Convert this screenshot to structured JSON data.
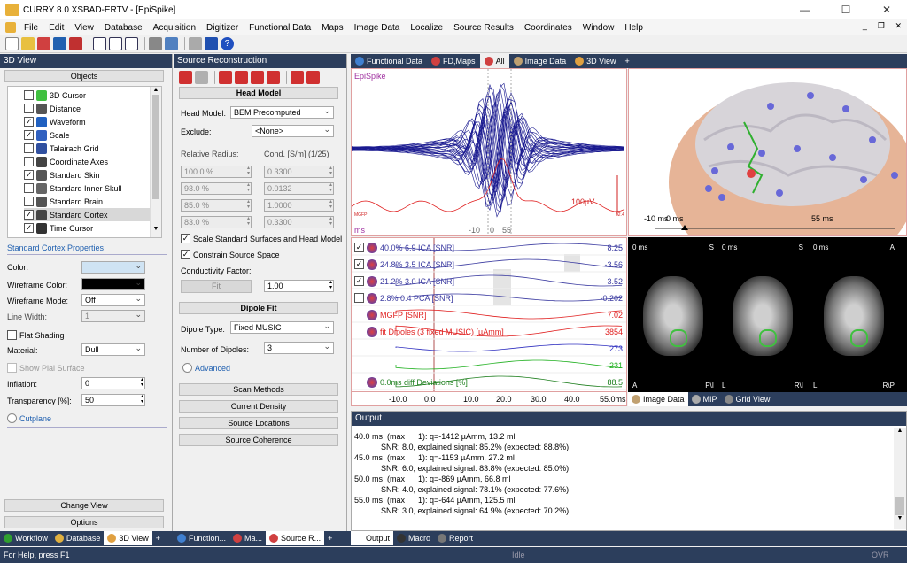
{
  "window": {
    "title": "CURRY 8.0 XSBAD-ERTV - [EpiSpike]",
    "min": "—",
    "max": "☐",
    "close": "✕"
  },
  "menu": [
    "File",
    "Edit",
    "View",
    "Database",
    "Acquisition",
    "Digitizer",
    "Functional Data",
    "Maps",
    "Image Data",
    "Localize",
    "Source Results",
    "Coordinates",
    "Window",
    "Help"
  ],
  "mdi": {
    "min": "_",
    "restore": "❐",
    "close": "✕"
  },
  "view3d": {
    "title": "3D View",
    "objects": "Objects",
    "items": [
      {
        "label": "3D Cursor",
        "checked": false
      },
      {
        "label": "Distance",
        "checked": false
      },
      {
        "label": "Waveform",
        "checked": true
      },
      {
        "label": "Scale",
        "checked": true
      },
      {
        "label": "Talairach Grid",
        "checked": false
      },
      {
        "label": "Coordinate Axes",
        "checked": false
      },
      {
        "label": "Standard Skin",
        "checked": true
      },
      {
        "label": "Standard Inner Skull",
        "checked": false
      },
      {
        "label": "Standard Brain",
        "checked": false
      },
      {
        "label": "Standard Cortex",
        "checked": true
      },
      {
        "label": "Time Cursor",
        "checked": true
      }
    ],
    "props_title": "Standard Cortex Properties",
    "color": "Color:",
    "wire_color": "Wireframe Color:",
    "wire_mode": "Wireframe Mode:",
    "wire_mode_val": "Off",
    "line_width": "Line Width:",
    "line_width_val": "1",
    "flat": "Flat Shading",
    "material": "Material:",
    "material_val": "Dull",
    "pial": "Show Pial Surface",
    "inflation": "Inflation:",
    "inflation_val": "0",
    "transparency": "Transparency [%]:",
    "transparency_val": "50",
    "cutplane": "Cutplane",
    "change_view": "Change View",
    "options": "Options"
  },
  "source": {
    "title": "Source Reconstruction",
    "head_model": "Head Model",
    "head_model_lbl": "Head Model:",
    "head_model_val": "BEM Precomputed",
    "exclude_lbl": "Exclude:",
    "exclude_val": "<None>",
    "rel_radius": "Relative Radius:",
    "cond": "Cond. [S/m] (1/25)",
    "radii": [
      "100.0 %",
      "93.0 %",
      "85.0 %",
      "83.0 %"
    ],
    "conds": [
      "0.3300",
      "0.0132",
      "1.0000",
      "0.3300"
    ],
    "scale_std": "Scale Standard Surfaces and Head Model",
    "constrain": "Constrain Source Space",
    "cond_factor": "Conductivity Factor:",
    "fit_btn": "Fit",
    "factor_val": "1.00",
    "dipole_fit": "Dipole Fit",
    "dipole_type_lbl": "Dipole Type:",
    "dipole_type_val": "Fixed MUSIC",
    "num_dip_lbl": "Number of Dipoles:",
    "num_dip_val": "3",
    "advanced": "Advanced",
    "buttons": [
      "Scan Methods",
      "Current Density",
      "Source Locations",
      "Source Coherence"
    ]
  },
  "tabs_top": [
    {
      "label": "Functional Data",
      "active": false
    },
    {
      "label": "FD,Maps",
      "active": false
    },
    {
      "label": "All",
      "active": true
    },
    {
      "label": "Image Data",
      "active": false
    },
    {
      "label": "3D View",
      "active": false
    },
    {
      "label": "+",
      "active": false
    }
  ],
  "butterfly": {
    "title": "EpiSpike",
    "scale": "100µV",
    "ms": "ms",
    "t_neg10": "-10",
    "t_0": "0",
    "t_55": "55",
    "mgfp": "MGFP",
    "right_val": "62.4"
  },
  "brain3d": {
    "t1": "-10 ms",
    "t2": "0 ms",
    "t3": "55 ms"
  },
  "traces": [
    {
      "label": "40.0% 6.9 ICA [SNR]",
      "value": "8.25",
      "checked": true,
      "color": "#3a3aa0"
    },
    {
      "label": "24.8% 3.5 ICA [SNR]",
      "value": "-3.56",
      "checked": true,
      "color": "#3a3aa0"
    },
    {
      "label": "21.2% 3.0 ICA [SNR]",
      "value": "3.52",
      "checked": true,
      "color": "#3a3aa0"
    },
    {
      "label": "2.8% 0.4 PCA [SNR]",
      "value": "-0.202",
      "checked": false,
      "color": "#3a3aa0"
    },
    {
      "label": "MGFP [SNR]",
      "value": "7.02",
      "checked": false,
      "color": "#e02020"
    },
    {
      "label": "fit  Dipoles (3 fixed MUSIC) [µAmm]",
      "value": "3854",
      "checked": false,
      "color": "#e02020"
    },
    {
      "label": "",
      "value": "273",
      "checked": false,
      "color": "#3030c0"
    },
    {
      "label": "",
      "value": "-231",
      "checked": false,
      "color": "#20b020"
    },
    {
      "label": "0.0ms diff  Deviations [%]",
      "value": "88.5",
      "checked": false,
      "color": "#208020"
    }
  ],
  "time_axis": [
    "-10.0",
    "0.0",
    "10.0",
    "20.0",
    "30.0",
    "40.0",
    "55.0ms"
  ],
  "mri": [
    {
      "time": "0 ms",
      "corner_tr": "S",
      "corner_bl": "A",
      "corner_br": "P\\I"
    },
    {
      "time": "0 ms",
      "corner_tr": "S",
      "corner_bl": "L",
      "corner_br": "R\\I"
    },
    {
      "time": "0 ms",
      "corner_tr": "A",
      "corner_bl": "L",
      "corner_br": "R\\P"
    }
  ],
  "image_tabs": [
    {
      "label": "Image Data",
      "active": true
    },
    {
      "label": "MIP",
      "active": false
    },
    {
      "label": "Grid View",
      "active": false
    }
  ],
  "output": {
    "title": "Output",
    "lines": [
      "40.0 ms  (max      1): q=-1412 µAmm, 13.2 ml",
      "            SNR: 8.0, explained signal: 85.2% (expected: 88.8%)",
      "45.0 ms  (max      1): q=-1153 µAmm, 27.2 ml",
      "            SNR: 6.0, explained signal: 83.8% (expected: 85.0%)",
      "50.0 ms  (max      1): q=-869 µAmm, 66.8 ml",
      "            SNR: 4.0, explained signal: 78.1% (expected: 77.6%)",
      "55.0 ms  (max      1): q=-644 µAmm, 125.5 ml",
      "            SNR: 3.0, explained signal: 64.9% (expected: 70.2%)"
    ]
  },
  "bottom_tabs_left": [
    {
      "label": "Workflow",
      "active": false
    },
    {
      "label": "Database",
      "active": false
    },
    {
      "label": "3D View",
      "active": true
    },
    {
      "label": "+",
      "active": false
    }
  ],
  "bottom_tabs_mid": [
    {
      "label": "Function...",
      "active": false
    },
    {
      "label": "Ma...",
      "active": false
    },
    {
      "label": "Source R...",
      "active": true
    },
    {
      "label": "+",
      "active": false
    }
  ],
  "bottom_tabs_right": [
    {
      "label": "Output",
      "active": true
    },
    {
      "label": "Macro",
      "active": false
    },
    {
      "label": "Report",
      "active": false
    }
  ],
  "status": {
    "help": "For Help, press F1",
    "state": "Idle",
    "mode": "OVR"
  }
}
